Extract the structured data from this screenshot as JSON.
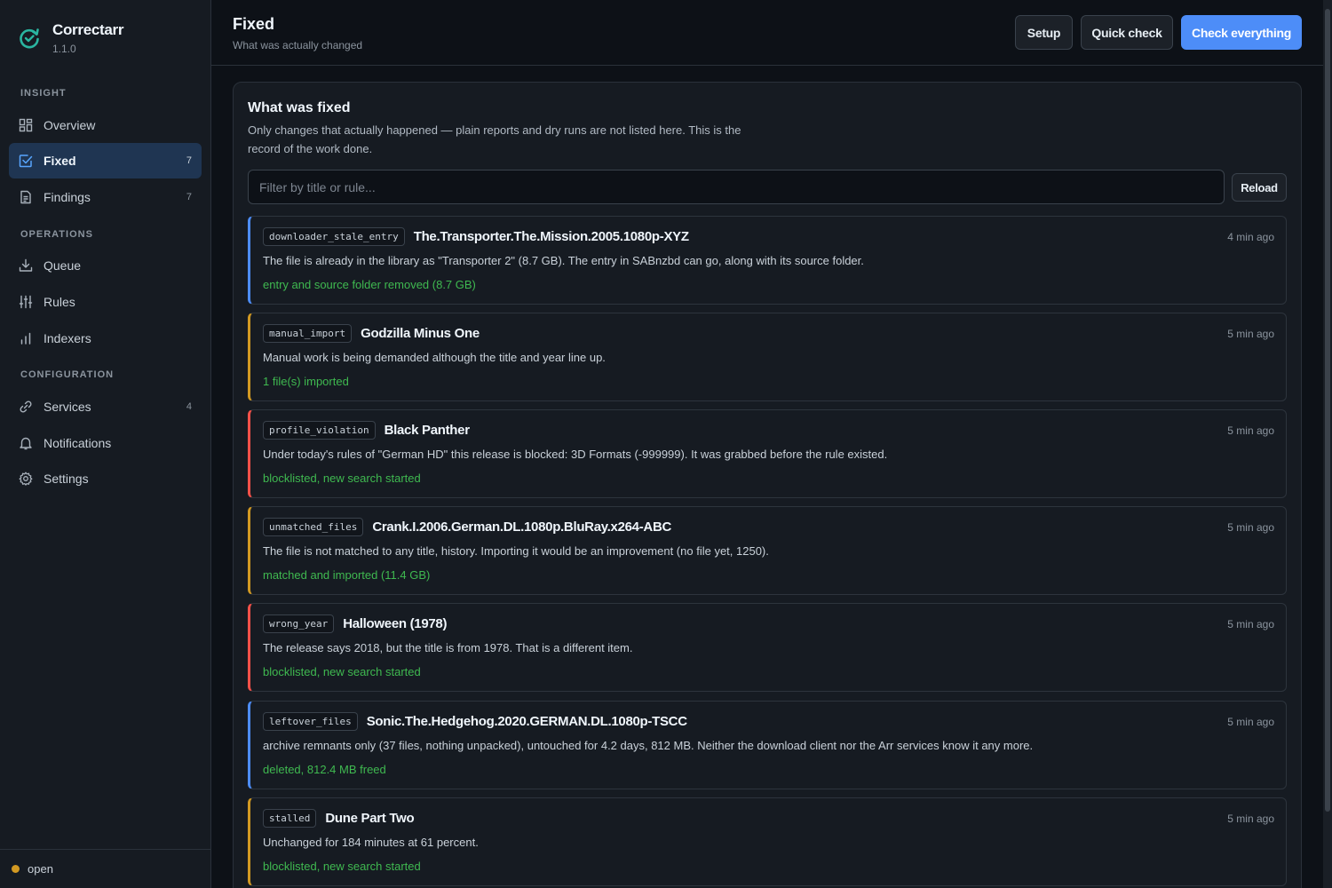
{
  "app": {
    "name": "Correctarr",
    "version": "1.1.0",
    "status": "open"
  },
  "sidebar": {
    "sections": [
      {
        "label": "INSIGHT"
      },
      {
        "label": "OPERATIONS"
      },
      {
        "label": "CONFIGURATION"
      }
    ],
    "items": [
      {
        "label": "Overview",
        "icon": "dashboard-icon",
        "count": ""
      },
      {
        "label": "Fixed",
        "icon": "checkbox-icon",
        "count": "7",
        "active": true
      },
      {
        "label": "Findings",
        "icon": "document-icon",
        "count": "7"
      },
      {
        "label": "Queue",
        "icon": "download-icon",
        "count": ""
      },
      {
        "label": "Rules",
        "icon": "sliders-icon",
        "count": ""
      },
      {
        "label": "Indexers",
        "icon": "bar-chart-icon",
        "count": ""
      },
      {
        "label": "Services",
        "icon": "link-icon",
        "count": "4"
      },
      {
        "label": "Notifications",
        "icon": "bell-icon",
        "count": ""
      },
      {
        "label": "Settings",
        "icon": "gear-icon",
        "count": ""
      }
    ]
  },
  "header": {
    "title": "Fixed",
    "subtitle": "What was actually changed",
    "buttons": {
      "setup": "Setup",
      "quick_check": "Quick check",
      "check_everything": "Check everything"
    }
  },
  "panel": {
    "title": "What was fixed",
    "description": "Only changes that actually happened — plain reports and dry runs are not listed here. This is the record of the work done.",
    "filter_placeholder": "Filter by title or rule...",
    "reload_label": "Reload"
  },
  "entries": [
    {
      "rule": "downloader_stale_entry",
      "title": "The.Transporter.The.Mission.2005.1080p-XYZ",
      "time": "4 min ago",
      "description": "The file is already in the library as \"Transporter 2\" (8.7 GB). The entry in SABnzbd can go, along with its source folder.",
      "result": "entry and source folder removed (8.7 GB)",
      "severity": "blue"
    },
    {
      "rule": "manual_import",
      "title": "Godzilla Minus One",
      "time": "5 min ago",
      "description": "Manual work is being demanded although the title and year line up.",
      "result": "1 file(s) imported",
      "severity": "orange"
    },
    {
      "rule": "profile_violation",
      "title": "Black Panther",
      "time": "5 min ago",
      "description": "Under today's rules of \"German HD\" this release is blocked: 3D Formats (-999999). It was grabbed before the rule existed.",
      "result": "blocklisted, new search started",
      "severity": "red"
    },
    {
      "rule": "unmatched_files",
      "title": "Crank.I.2006.German.DL.1080p.BluRay.x264-ABC",
      "time": "5 min ago",
      "description": "The file is not matched to any title, history. Importing it would be an improvement (no file yet, 1250).",
      "result": "matched and imported (11.4 GB)",
      "severity": "orange"
    },
    {
      "rule": "wrong_year",
      "title": "Halloween (1978)",
      "time": "5 min ago",
      "description": "The release says 2018, but the title is from 1978. That is a different item.",
      "result": "blocklisted, new search started",
      "severity": "red"
    },
    {
      "rule": "leftover_files",
      "title": "Sonic.The.Hedgehog.2020.GERMAN.DL.1080p-TSCC",
      "time": "5 min ago",
      "description": "archive remnants only (37 files, nothing unpacked), untouched for 4.2 days, 812 MB. Neither the download client nor the Arr services know it any more.",
      "result": "deleted, 812.4 MB freed",
      "severity": "blue"
    },
    {
      "rule": "stalled",
      "title": "Dune Part Two",
      "time": "5 min ago",
      "description": "Unchanged for 184 minutes at 61 percent.",
      "result": "blocklisted, new search started",
      "severity": "orange"
    }
  ],
  "colors": {
    "accent": "#4d8df8",
    "success": "#3fb950",
    "warning": "#d29922",
    "danger": "#f85149"
  }
}
